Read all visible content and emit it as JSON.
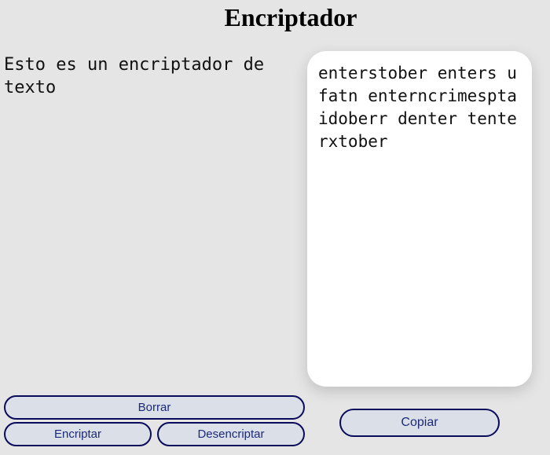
{
  "header": {
    "title": "Encriptador"
  },
  "input": {
    "value": "Esto es un encriptador de texto"
  },
  "output": {
    "text": "enterstober enters ufatn enterncrimesptaidoberr denter tenterxtober"
  },
  "buttons": {
    "borrar": "Borrar",
    "encriptar": "Encriptar",
    "desencriptar": "Desencriptar",
    "copiar": "Copiar"
  },
  "colors": {
    "background": "#e5e5e5",
    "button_fill": "#dadfe8",
    "button_border": "#0b0b5c",
    "button_text": "#1d2a7a",
    "panel": "#ffffff"
  }
}
